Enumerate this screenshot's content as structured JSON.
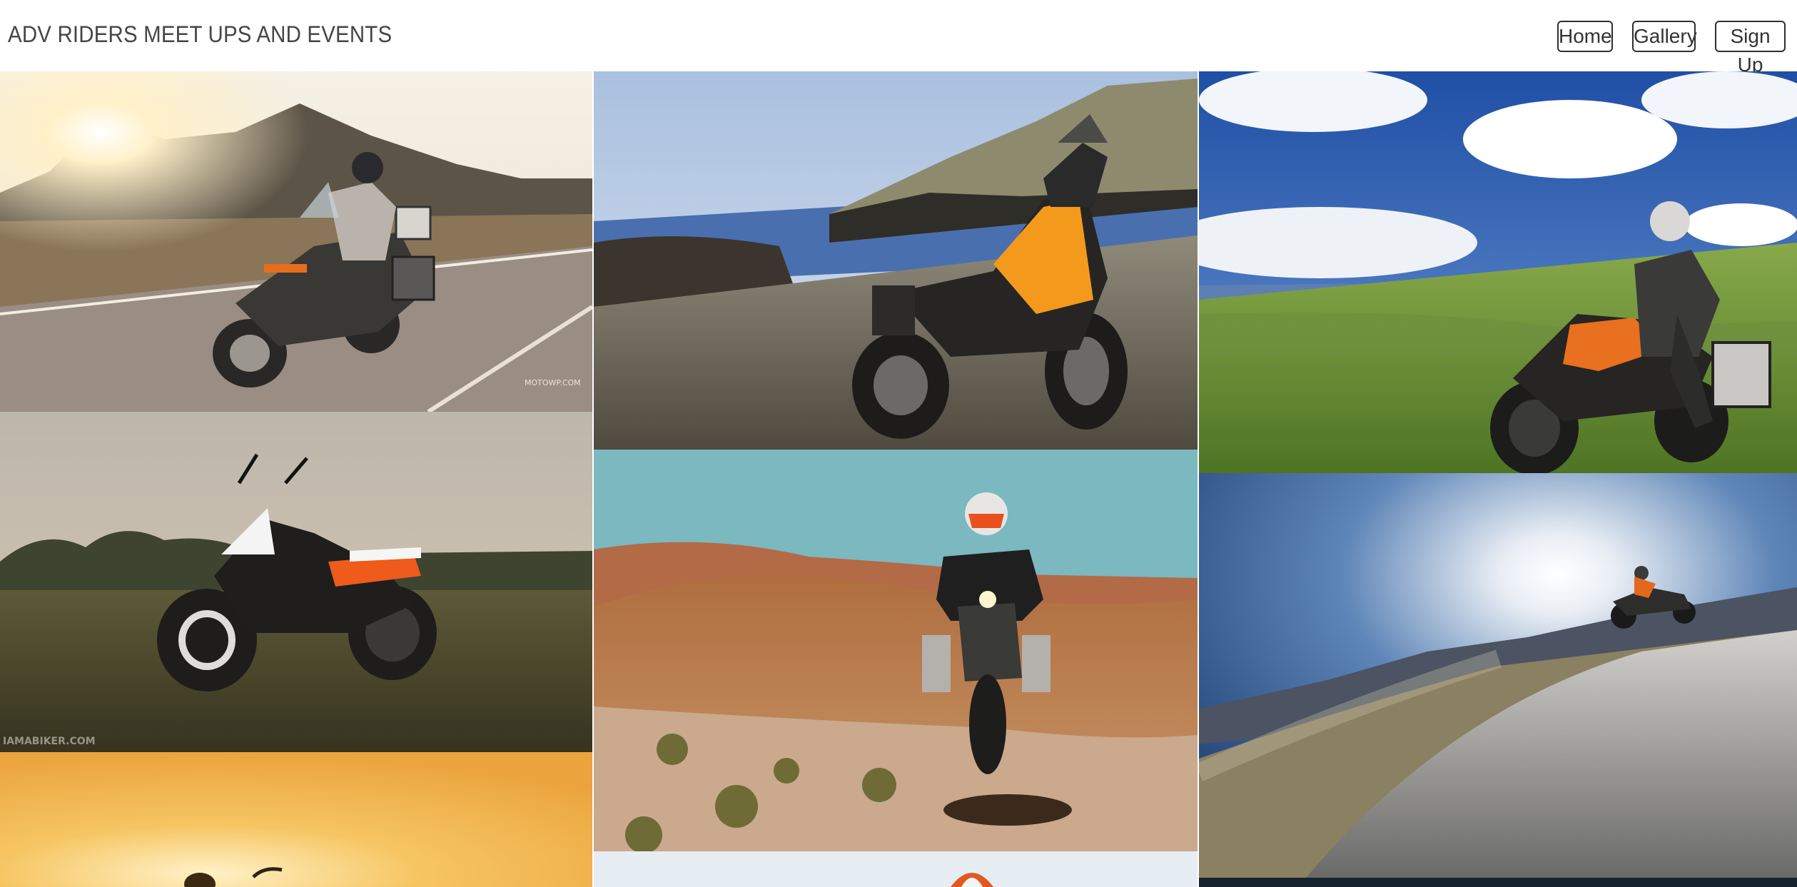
{
  "header": {
    "site_title": "ADV RIDERS MEET UPS AND EVENTS",
    "nav": {
      "home": "Home",
      "gallery": "Gallery",
      "signup": "Sign Up"
    }
  },
  "gallery": {
    "photos": [
      {
        "scene": "sunset-road-adventure-bike",
        "watermark": "MOTOWP.COM"
      },
      {
        "scene": "orange-adventure-bike-on-rocks-by-sea"
      },
      {
        "scene": "rider-on-orange-adventure-bike-green-hills"
      },
      {
        "scene": "naked-bike-in-grass-field",
        "watermark": "IAMABIKER.COM"
      },
      {
        "scene": "rider-jumping-desert"
      },
      {
        "scene": "rider-on-dune-backlit"
      },
      {
        "scene": "golden-sunset-rider"
      },
      {
        "scene": "rider-helmet-partial"
      },
      {
        "scene": "dark-partial-photo"
      }
    ]
  }
}
